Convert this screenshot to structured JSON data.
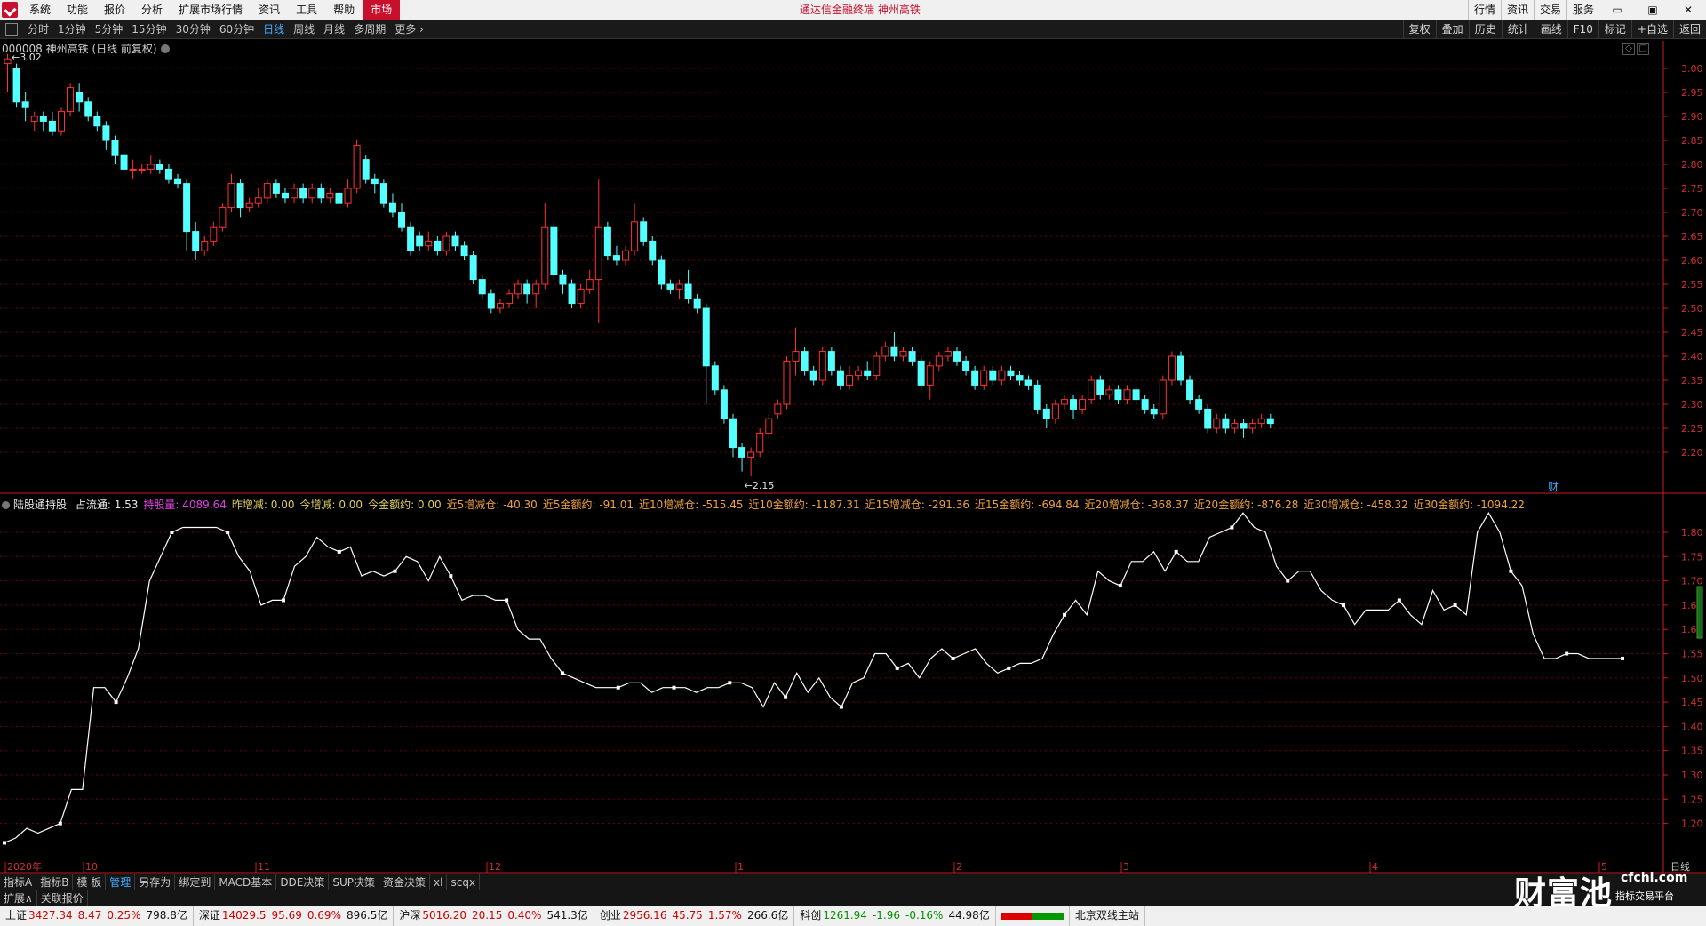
{
  "menu": {
    "items": [
      "系统",
      "功能",
      "报价",
      "分析",
      "扩展市场行情",
      "资讯",
      "工具",
      "帮助",
      "市场"
    ],
    "title": "通达信金融终端  神州高铁",
    "right": [
      "行情",
      "资讯",
      "交易",
      "服务"
    ]
  },
  "periods": {
    "items": [
      "分时",
      "1分钟",
      "5分钟",
      "15分钟",
      "30分钟",
      "60分钟",
      "日线",
      "周线",
      "月线",
      "多周期",
      "更多 ›"
    ],
    "selected": "日线",
    "right": [
      "复权",
      "叠加",
      "历史",
      "统计",
      "画线",
      "F10",
      "标记",
      "+自选",
      "返回"
    ]
  },
  "stock": {
    "code_name": "000008 神州高铁 (日线 前复权)",
    "max_label": "3.02",
    "min_label": "2.15",
    "cai_badge": "财"
  },
  "price_axis": [
    "3.00",
    "2.95",
    "2.90",
    "2.85",
    "2.80",
    "2.75",
    "2.70",
    "2.65",
    "2.60",
    "2.55",
    "2.50",
    "2.45",
    "2.40",
    "2.35",
    "2.30",
    "2.25",
    "2.20"
  ],
  "ind_axis": [
    "1.80",
    "1.75",
    "1.70",
    "1.65",
    "1.60",
    "1.55",
    "1.50",
    "1.45",
    "1.40",
    "1.35",
    "1.30",
    "1.25",
    "1.20"
  ],
  "indicator": {
    "name": "陆股通持股",
    "fields": [
      {
        "label": "占流通:",
        "value": "1.53",
        "color": "w"
      },
      {
        "label": "持股量:",
        "value": "4089.64",
        "color": "m"
      },
      {
        "label": "昨增减:",
        "value": "0.00",
        "color": "y"
      },
      {
        "label": "今增减:",
        "value": "0.00",
        "color": "y"
      },
      {
        "label": "今金额约:",
        "value": "0.00",
        "color": "y"
      },
      {
        "label": "近5增减仓:",
        "value": "-40.30",
        "color": "o"
      },
      {
        "label": "近5金额约:",
        "value": "-91.01",
        "color": "o"
      },
      {
        "label": "近10增减仓:",
        "value": "-515.45",
        "color": "o"
      },
      {
        "label": "近10金额约:",
        "value": "-1187.31",
        "color": "o"
      },
      {
        "label": "近15增减仓:",
        "value": "-291.36",
        "color": "o"
      },
      {
        "label": "近15金额约:",
        "value": "-694.84",
        "color": "o"
      },
      {
        "label": "近20增减仓:",
        "value": "-368.37",
        "color": "o"
      },
      {
        "label": "近20金额约:",
        "value": "-876.28",
        "color": "o"
      },
      {
        "label": "近30增减仓:",
        "value": "-458.32",
        "color": "o"
      },
      {
        "label": "近30金额约:",
        "value": "-1094.22",
        "color": "o"
      }
    ]
  },
  "date_axis": {
    "labels": [
      "2020年",
      "10",
      "11",
      "12",
      "1",
      "2",
      "3",
      "4",
      "5"
    ],
    "period_label": "日线"
  },
  "tabs": [
    "指标A",
    "指标B",
    "模 板",
    "管理",
    "另存为",
    "绑定到",
    "MACD基本",
    "DDE决策",
    "SUP决策",
    "资金决策",
    "xl",
    "scqx"
  ],
  "tabs_selected": "管理",
  "ext_tabs": [
    "扩展∧",
    "关联报价"
  ],
  "status": [
    {
      "name": "上证",
      "price": "3427.34",
      "chg": "8.47",
      "pct": "0.25%",
      "vol": "798.8亿",
      "dir": "up"
    },
    {
      "name": "深证",
      "price": "14029.5",
      "chg": "95.69",
      "pct": "0.69%",
      "vol": "896.5亿",
      "dir": "up"
    },
    {
      "name": "沪深",
      "price": "5016.20",
      "chg": "20.15",
      "pct": "0.40%",
      "vol": "541.3亿",
      "dir": "up"
    },
    {
      "name": "创业",
      "price": "2956.16",
      "chg": "45.75",
      "pct": "1.57%",
      "vol": "266.6亿",
      "dir": "up"
    },
    {
      "name": "科创",
      "price": "1261.94",
      "chg": "-1.96",
      "pct": "-0.16%",
      "vol": "44.98亿",
      "dir": "dn"
    }
  ],
  "server": "北京双线主站",
  "brand": {
    "name": "财富池",
    "url": "cfchi.com",
    "slogan": "指标交易平台"
  },
  "colors": {
    "up": "#ff3232",
    "down": "#54ffff",
    "line": "#ffffff",
    "grid": "#7a0000",
    "axis": "#c81e1e"
  },
  "chart_data": [
    {
      "type": "candlestick",
      "title": "000008 神州高铁 (日线 前复权)",
      "ylim": [
        2.15,
        3.03
      ],
      "candles": [
        [
          3.01,
          3.02,
          2.95,
          3.03
        ],
        [
          3.0,
          2.93,
          2.92,
          3.01
        ],
        [
          2.93,
          2.92,
          2.89,
          2.95
        ],
        [
          2.89,
          2.9,
          2.87,
          2.91
        ],
        [
          2.9,
          2.89,
          2.87,
          2.91
        ],
        [
          2.89,
          2.87,
          2.86,
          2.91
        ],
        [
          2.87,
          2.91,
          2.86,
          2.92
        ],
        [
          2.91,
          2.96,
          2.9,
          2.97
        ],
        [
          2.95,
          2.93,
          2.91,
          2.97
        ],
        [
          2.93,
          2.9,
          2.89,
          2.94
        ],
        [
          2.9,
          2.88,
          2.87,
          2.91
        ],
        [
          2.88,
          2.85,
          2.83,
          2.89
        ],
        [
          2.85,
          2.82,
          2.8,
          2.86
        ],
        [
          2.82,
          2.79,
          2.78,
          2.84
        ],
        [
          2.79,
          2.79,
          2.77,
          2.81
        ],
        [
          2.79,
          2.79,
          2.78,
          2.8
        ],
        [
          2.79,
          2.8,
          2.78,
          2.82
        ],
        [
          2.8,
          2.79,
          2.78,
          2.81
        ],
        [
          2.79,
          2.77,
          2.76,
          2.8
        ],
        [
          2.77,
          2.76,
          2.75,
          2.78
        ],
        [
          2.76,
          2.66,
          2.62,
          2.77
        ],
        [
          2.66,
          2.62,
          2.6,
          2.68
        ],
        [
          2.62,
          2.64,
          2.61,
          2.65
        ],
        [
          2.64,
          2.67,
          2.63,
          2.68
        ],
        [
          2.67,
          2.71,
          2.66,
          2.72
        ],
        [
          2.71,
          2.76,
          2.7,
          2.78
        ],
        [
          2.76,
          2.71,
          2.69,
          2.77
        ],
        [
          2.71,
          2.72,
          2.7,
          2.73
        ],
        [
          2.72,
          2.73,
          2.71,
          2.75
        ],
        [
          2.73,
          2.76,
          2.72,
          2.77
        ],
        [
          2.76,
          2.74,
          2.73,
          2.77
        ],
        [
          2.74,
          2.73,
          2.72,
          2.75
        ],
        [
          2.73,
          2.75,
          2.72,
          2.76
        ],
        [
          2.75,
          2.73,
          2.72,
          2.76
        ],
        [
          2.73,
          2.75,
          2.72,
          2.76
        ],
        [
          2.75,
          2.73,
          2.72,
          2.76
        ],
        [
          2.73,
          2.74,
          2.72,
          2.75
        ],
        [
          2.74,
          2.72,
          2.71,
          2.75
        ],
        [
          2.72,
          2.75,
          2.71,
          2.77
        ],
        [
          2.75,
          2.84,
          2.74,
          2.85
        ],
        [
          2.81,
          2.77,
          2.76,
          2.82
        ],
        [
          2.77,
          2.76,
          2.74,
          2.78
        ],
        [
          2.76,
          2.72,
          2.71,
          2.77
        ],
        [
          2.72,
          2.7,
          2.69,
          2.74
        ],
        [
          2.7,
          2.67,
          2.66,
          2.72
        ],
        [
          2.67,
          2.62,
          2.61,
          2.68
        ],
        [
          2.65,
          2.63,
          2.62,
          2.66
        ],
        [
          2.63,
          2.64,
          2.62,
          2.66
        ],
        [
          2.64,
          2.62,
          2.61,
          2.65
        ],
        [
          2.62,
          2.65,
          2.61,
          2.66
        ],
        [
          2.65,
          2.63,
          2.62,
          2.66
        ],
        [
          2.63,
          2.61,
          2.6,
          2.64
        ],
        [
          2.61,
          2.56,
          2.55,
          2.62
        ],
        [
          2.56,
          2.53,
          2.52,
          2.57
        ],
        [
          2.53,
          2.5,
          2.49,
          2.54
        ],
        [
          2.5,
          2.51,
          2.49,
          2.52
        ],
        [
          2.51,
          2.53,
          2.5,
          2.54
        ],
        [
          2.53,
          2.55,
          2.52,
          2.56
        ],
        [
          2.55,
          2.53,
          2.51,
          2.56
        ],
        [
          2.53,
          2.55,
          2.5,
          2.56
        ],
        [
          2.55,
          2.67,
          2.54,
          2.72
        ],
        [
          2.67,
          2.57,
          2.56,
          2.68
        ],
        [
          2.57,
          2.55,
          2.53,
          2.58
        ],
        [
          2.55,
          2.51,
          2.5,
          2.56
        ],
        [
          2.51,
          2.54,
          2.5,
          2.55
        ],
        [
          2.54,
          2.56,
          2.53,
          2.58
        ],
        [
          2.56,
          2.67,
          2.47,
          2.77
        ],
        [
          2.67,
          2.61,
          2.6,
          2.68
        ],
        [
          2.61,
          2.6,
          2.59,
          2.63
        ],
        [
          2.6,
          2.62,
          2.59,
          2.63
        ],
        [
          2.62,
          2.68,
          2.61,
          2.72
        ],
        [
          2.68,
          2.64,
          2.63,
          2.69
        ],
        [
          2.64,
          2.6,
          2.59,
          2.65
        ],
        [
          2.6,
          2.55,
          2.54,
          2.61
        ],
        [
          2.55,
          2.54,
          2.53,
          2.56
        ],
        [
          2.54,
          2.55,
          2.52,
          2.56
        ],
        [
          2.55,
          2.52,
          2.51,
          2.58
        ],
        [
          2.52,
          2.5,
          2.49,
          2.53
        ],
        [
          2.5,
          2.38,
          2.3,
          2.51
        ],
        [
          2.38,
          2.33,
          2.32,
          2.39
        ],
        [
          2.33,
          2.27,
          2.26,
          2.34
        ],
        [
          2.27,
          2.21,
          2.19,
          2.28
        ],
        [
          2.21,
          2.19,
          2.16,
          2.22
        ],
        [
          2.19,
          2.2,
          2.15,
          2.21
        ],
        [
          2.2,
          2.24,
          2.19,
          2.25
        ],
        [
          2.24,
          2.27,
          2.23,
          2.28
        ],
        [
          2.28,
          2.3,
          2.27,
          2.31
        ],
        [
          2.3,
          2.39,
          2.29,
          2.4
        ],
        [
          2.39,
          2.41,
          2.36,
          2.46
        ],
        [
          2.41,
          2.37,
          2.36,
          2.42
        ],
        [
          2.37,
          2.35,
          2.34,
          2.38
        ],
        [
          2.35,
          2.41,
          2.34,
          2.42
        ],
        [
          2.41,
          2.37,
          2.36,
          2.42
        ],
        [
          2.37,
          2.34,
          2.33,
          2.38
        ],
        [
          2.34,
          2.36,
          2.33,
          2.38
        ],
        [
          2.36,
          2.37,
          2.35,
          2.38
        ],
        [
          2.37,
          2.36,
          2.35,
          2.39
        ],
        [
          2.36,
          2.4,
          2.35,
          2.41
        ],
        [
          2.4,
          2.42,
          2.39,
          2.43
        ],
        [
          2.42,
          2.4,
          2.39,
          2.45
        ],
        [
          2.4,
          2.41,
          2.39,
          2.42
        ],
        [
          2.41,
          2.39,
          2.38,
          2.42
        ],
        [
          2.39,
          2.34,
          2.33,
          2.4
        ],
        [
          2.34,
          2.38,
          2.31,
          2.39
        ],
        [
          2.38,
          2.4,
          2.37,
          2.41
        ],
        [
          2.4,
          2.41,
          2.39,
          2.42
        ],
        [
          2.41,
          2.39,
          2.38,
          2.42
        ],
        [
          2.39,
          2.37,
          2.36,
          2.4
        ],
        [
          2.37,
          2.34,
          2.33,
          2.38
        ],
        [
          2.34,
          2.37,
          2.33,
          2.38
        ],
        [
          2.37,
          2.35,
          2.34,
          2.38
        ],
        [
          2.35,
          2.37,
          2.34,
          2.38
        ],
        [
          2.37,
          2.36,
          2.35,
          2.38
        ],
        [
          2.36,
          2.35,
          2.34,
          2.37
        ],
        [
          2.35,
          2.34,
          2.33,
          2.36
        ],
        [
          2.34,
          2.29,
          2.28,
          2.35
        ],
        [
          2.29,
          2.27,
          2.25,
          2.3
        ],
        [
          2.27,
          2.3,
          2.26,
          2.31
        ],
        [
          2.3,
          2.31,
          2.29,
          2.32
        ],
        [
          2.31,
          2.29,
          2.27,
          2.32
        ],
        [
          2.29,
          2.31,
          2.28,
          2.32
        ],
        [
          2.31,
          2.35,
          2.3,
          2.36
        ],
        [
          2.35,
          2.32,
          2.31,
          2.36
        ],
        [
          2.32,
          2.33,
          2.31,
          2.34
        ],
        [
          2.33,
          2.31,
          2.3,
          2.34
        ],
        [
          2.31,
          2.33,
          2.3,
          2.34
        ],
        [
          2.33,
          2.31,
          2.3,
          2.34
        ],
        [
          2.31,
          2.29,
          2.28,
          2.32
        ],
        [
          2.29,
          2.28,
          2.27,
          2.3
        ],
        [
          2.28,
          2.35,
          2.27,
          2.36
        ],
        [
          2.35,
          2.4,
          2.34,
          2.41
        ],
        [
          2.4,
          2.35,
          2.34,
          2.41
        ],
        [
          2.35,
          2.31,
          2.3,
          2.36
        ],
        [
          2.31,
          2.29,
          2.28,
          2.32
        ],
        [
          2.29,
          2.25,
          2.24,
          2.3
        ],
        [
          2.25,
          2.27,
          2.24,
          2.28
        ],
        [
          2.27,
          2.25,
          2.24,
          2.28
        ],
        [
          2.25,
          2.26,
          2.24,
          2.27
        ],
        [
          2.26,
          2.25,
          2.23,
          2.27
        ],
        [
          2.25,
          2.26,
          2.24,
          2.27
        ],
        [
          2.26,
          2.27,
          2.25,
          2.28
        ],
        [
          2.27,
          2.26,
          2.25,
          2.28
        ]
      ]
    },
    {
      "type": "line",
      "title": "陆股通持股",
      "ylim": [
        1.15,
        1.86
      ],
      "values": [
        1.16,
        1.17,
        1.19,
        1.18,
        1.19,
        1.2,
        1.27,
        1.27,
        1.48,
        1.48,
        1.45,
        1.5,
        1.56,
        1.7,
        1.75,
        1.8,
        1.81,
        1.81,
        1.81,
        1.81,
        1.8,
        1.75,
        1.72,
        1.65,
        1.66,
        1.66,
        1.73,
        1.75,
        1.79,
        1.77,
        1.76,
        1.77,
        1.71,
        1.72,
        1.71,
        1.72,
        1.75,
        1.74,
        1.7,
        1.75,
        1.71,
        1.66,
        1.67,
        1.67,
        1.66,
        1.66,
        1.6,
        1.58,
        1.58,
        1.54,
        1.51,
        1.5,
        1.49,
        1.48,
        1.48,
        1.48,
        1.49,
        1.49,
        1.47,
        1.48,
        1.48,
        1.48,
        1.47,
        1.48,
        1.48,
        1.49,
        1.49,
        1.48,
        1.44,
        1.49,
        1.46,
        1.51,
        1.47,
        1.5,
        1.46,
        1.44,
        1.49,
        1.5,
        1.55,
        1.55,
        1.52,
        1.53,
        1.5,
        1.54,
        1.56,
        1.54,
        1.55,
        1.56,
        1.53,
        1.51,
        1.52,
        1.53,
        1.53,
        1.54,
        1.59,
        1.63,
        1.66,
        1.63,
        1.72,
        1.7,
        1.69,
        1.74,
        1.74,
        1.76,
        1.72,
        1.76,
        1.74,
        1.74,
        1.79,
        1.8,
        1.81,
        1.84,
        1.81,
        1.8,
        1.73,
        1.7,
        1.72,
        1.72,
        1.68,
        1.66,
        1.65,
        1.61,
        1.64,
        1.64,
        1.64,
        1.66,
        1.63,
        1.61,
        1.68,
        1.64,
        1.65,
        1.63,
        1.8,
        1.84,
        1.8,
        1.72,
        1.69,
        1.59,
        1.54,
        1.54,
        1.55,
        1.55,
        1.54,
        1.54,
        1.54,
        1.54
      ]
    }
  ]
}
